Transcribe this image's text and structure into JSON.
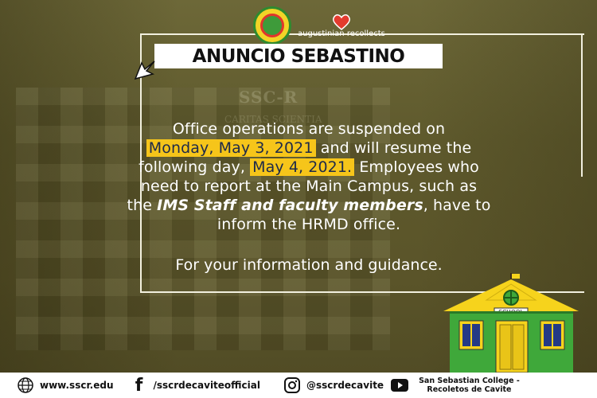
{
  "header": {
    "logo_caption": "augustinian recollects",
    "title": "ANUNCIO SEBASTINO"
  },
  "background": {
    "sign_line1": "SSC-R",
    "sign_line2": "CARITAS SCIENTIA"
  },
  "announcement": {
    "line1_pre": "Office operations are suspended on",
    "date1": "Monday, May 3, 2021",
    "line2_post": " and will resume the",
    "line3_pre": "following day, ",
    "date2": "May 4, 2021.",
    "line3_post": " Employees who",
    "line4": "need to report at the Main Campus, such as",
    "line5_pre": "the ",
    "emphasis": "IMS Staff and faculty members",
    "line5_post": ", have to",
    "line6": "inform the HRMD office."
  },
  "closing": "For your information and guidance.",
  "school_sign": "SCHOOL",
  "footer": {
    "website": "www.sscr.edu",
    "facebook": "/sscrdecaviteofficial",
    "instagram": "@sscrdecavite",
    "college_line1": "San Sebastian College -",
    "college_line2": "Recoletos de Cavite"
  },
  "colors": {
    "highlight": "#f6c51a",
    "background": "#5f5a2e",
    "school_green": "#3fa83a",
    "school_roof": "#f6d31c"
  }
}
